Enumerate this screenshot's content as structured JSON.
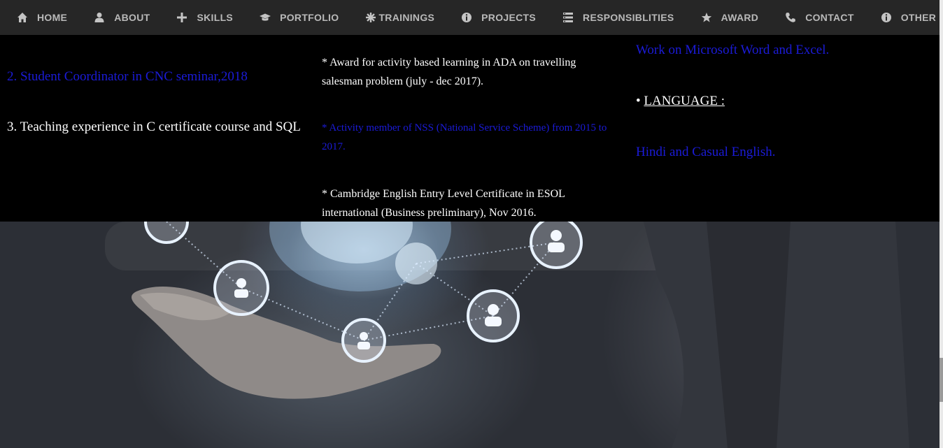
{
  "nav": {
    "items": [
      {
        "label": "HOME",
        "icon": "home-icon"
      },
      {
        "label": "ABOUT",
        "icon": "user-icon"
      },
      {
        "label": "SKILLS",
        "icon": "plus-icon"
      },
      {
        "label": "PORTFOLIO",
        "icon": "graduation-cap-icon"
      },
      {
        "label": "TRAININGS",
        "icon": "asterisk-icon"
      },
      {
        "label": "PROJECTS",
        "icon": "info-circle-icon"
      },
      {
        "label": "RESPONSIBLITIES",
        "icon": "list-icon"
      },
      {
        "label": "AWARD",
        "icon": "star-icon"
      },
      {
        "label": "CONTACT",
        "icon": "phone-icon"
      },
      {
        "label": "OTHER",
        "icon": "info-circle-icon"
      }
    ]
  },
  "responsibilities": {
    "item2": "2. Student Coordinator in CNC seminar,2018",
    "item3": "3. Teaching experience in C certificate course and SQL"
  },
  "awards": {
    "item1": "* Award for activity based learning in ADA on travelling salesman problem (july - dec 2017).",
    "item2": "* Activity member of NSS (National Service Scheme) from 2015 to 2017.",
    "item3": "* Cambridge English Entry Level Certificate in ESOL international (Business preliminary), Nov 2016."
  },
  "other": {
    "skill_text": "Work on Microsoft Word and Excel.",
    "language_bullet": "•",
    "language_heading": "LANGUAGE :",
    "language_text": "Hindi and Casual English."
  },
  "colors": {
    "nav_bg": "#262626",
    "nav_text": "#b9b9b9",
    "panel_bg": "#000000",
    "blue_text": "#1b1bd8",
    "white_text": "#ffffff"
  }
}
